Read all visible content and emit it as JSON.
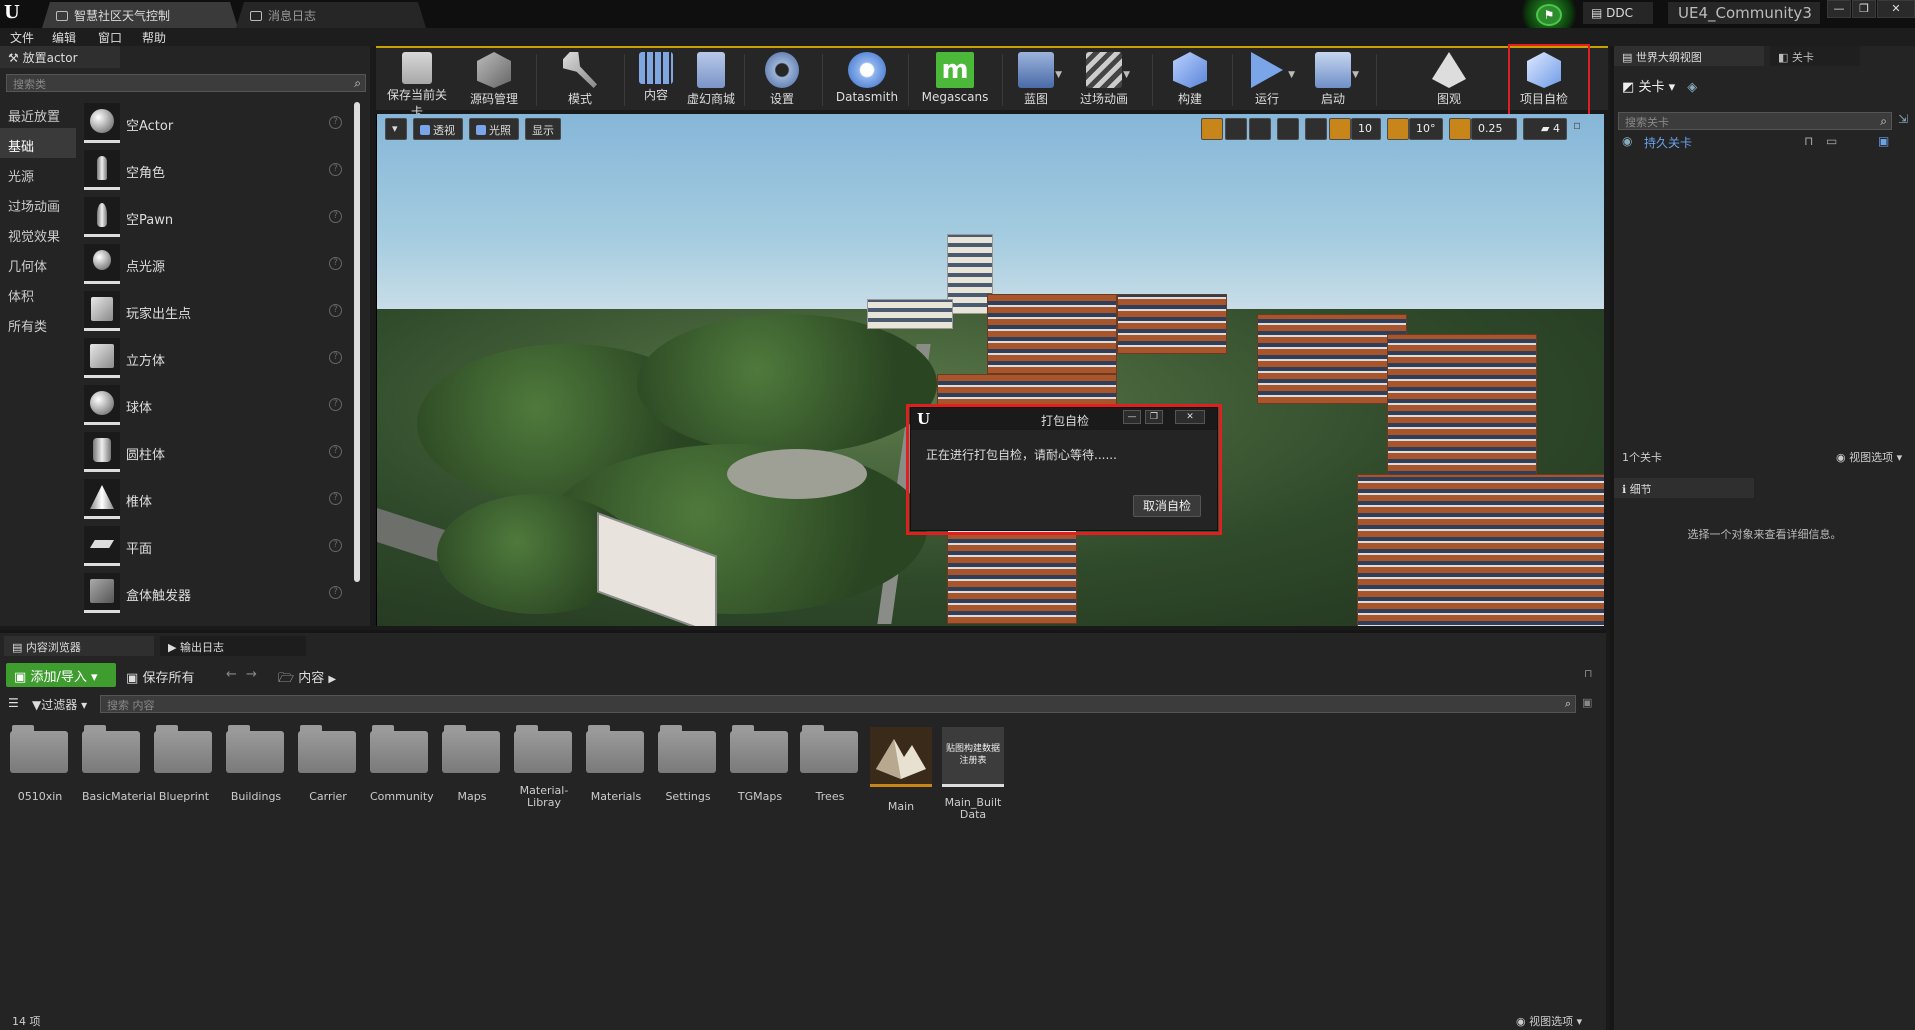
{
  "titlebar": {
    "tabs": [
      {
        "label": "智慧社区天气控制"
      },
      {
        "label": "消息日志"
      }
    ],
    "ddc_label": "DDC",
    "project_name": "UE4_Community3",
    "window_buttons": [
      "—",
      "❐",
      "✕"
    ]
  },
  "menu": [
    "文件",
    "编辑",
    "窗口",
    "帮助"
  ],
  "place_actor": {
    "tab_label": "放置actor",
    "search_placeholder": "搜索类",
    "categories": [
      "最近放置",
      "基础",
      "光源",
      "过场动画",
      "视觉效果",
      "几何体",
      "体积",
      "所有类"
    ],
    "active_category": "基础",
    "items": [
      {
        "label": "空Actor",
        "icon": "sphere"
      },
      {
        "label": "空角色",
        "icon": "figure"
      },
      {
        "label": "空Pawn",
        "icon": "pawn"
      },
      {
        "label": "点光源",
        "icon": "bulb"
      },
      {
        "label": "玩家出生点",
        "icon": "spawn"
      },
      {
        "label": "立方体",
        "icon": "cube"
      },
      {
        "label": "球体",
        "icon": "sphere"
      },
      {
        "label": "圆柱体",
        "icon": "cylinder"
      },
      {
        "label": "椎体",
        "icon": "cone"
      },
      {
        "label": "平面",
        "icon": "plane"
      },
      {
        "label": "盒体触发器",
        "icon": "box-trigger"
      }
    ]
  },
  "toolbar": {
    "items": [
      {
        "label": "保存当前关卡",
        "icon": "save-icon"
      },
      {
        "label": "源码管理",
        "icon": "source-control-icon"
      },
      {
        "label": "模式",
        "icon": "modes-icon"
      },
      {
        "label": "内容",
        "icon": "content-icon"
      },
      {
        "label": "虚幻商城",
        "icon": "marketplace-icon"
      },
      {
        "label": "设置",
        "icon": "settings-icon"
      },
      {
        "label": "Datasmith",
        "icon": "datasmith-icon"
      },
      {
        "label": "Megascans",
        "icon": "megascans-icon"
      },
      {
        "label": "蓝图",
        "icon": "blueprint-icon"
      },
      {
        "label": "过场动画",
        "icon": "cinematics-icon"
      },
      {
        "label": "构建",
        "icon": "build-icon"
      },
      {
        "label": "运行",
        "icon": "play-icon"
      },
      {
        "label": "启动",
        "icon": "launch-icon"
      },
      {
        "label": "图观",
        "icon": "tuguan-icon"
      },
      {
        "label": "项目自检",
        "icon": "project-check-icon"
      }
    ]
  },
  "viewport": {
    "perspective_label": "透视",
    "lit_label": "光照",
    "show_label": "显示",
    "grid_snap": "10",
    "rotation_snap": "10°",
    "scale_snap": "0.25",
    "camera_speed": "4"
  },
  "dialog": {
    "title": "打包自检",
    "message": "正在进行打包自检，请耐心等待......",
    "cancel_label": "取消自检"
  },
  "world_outliner": {
    "tab_label": "世界大纲视图",
    "tab2_label": "关卡",
    "levels_button": "关卡",
    "search_placeholder": "搜索关卡",
    "persistent_level": "持久关卡",
    "level_count": "1个关卡",
    "view_options": "视图选项"
  },
  "details": {
    "tab_label": "细节",
    "empty_message": "选择一个对象来查看详细信息。"
  },
  "content_browser": {
    "tab_label": "内容浏览器",
    "tab2_label": "输出日志",
    "add_import_label": "添加/导入",
    "save_all_label": "保存所有",
    "path_label": "内容",
    "filter_label": "过滤器",
    "search_placeholder": "搜索 内容",
    "folders": [
      "0510xin",
      "BasicMaterial",
      "Blueprint",
      "Buildings",
      "Carrier",
      "Community",
      "Maps",
      "Material-Libray",
      "Materials",
      "Settings",
      "TGMaps",
      "Trees"
    ],
    "assets": [
      {
        "label": "Main",
        "type": "map"
      },
      {
        "label": "Main_Built Data",
        "type": "data",
        "thumb_text": "贴图构建数据注册表"
      }
    ],
    "item_count": "14 项",
    "view_options": "视图选项"
  }
}
